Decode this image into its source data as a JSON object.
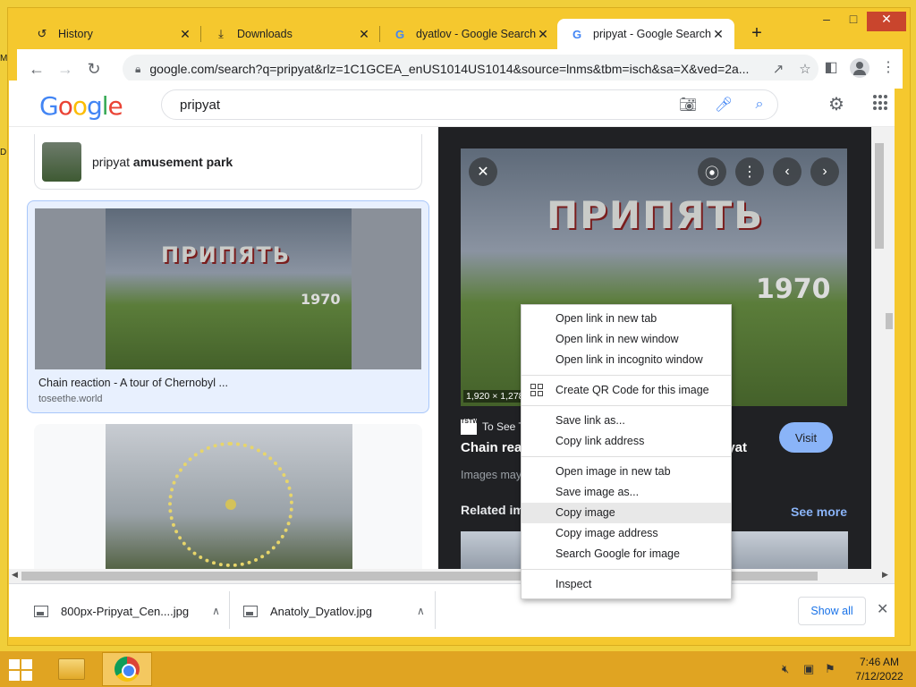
{
  "tabs": [
    {
      "label": "History",
      "icon": "history-icon"
    },
    {
      "label": "Downloads",
      "icon": "download-icon"
    },
    {
      "label": "dyatlov - Google Search",
      "icon": "google-icon"
    },
    {
      "label": "pripyat - Google Search",
      "icon": "google-icon",
      "active": true
    }
  ],
  "toolbar": {
    "url": "google.com/search?q=pripyat&rlz=1C1GCEA_enUS1014US1014&source=lnms&tbm=isch&sa=X&ved=2a..."
  },
  "google": {
    "logo": [
      "G",
      "o",
      "o",
      "g",
      "l",
      "e"
    ],
    "query": "pripyat"
  },
  "results": {
    "suggestion_prefix": "pripyat",
    "suggestion_bold": "amusement park",
    "card1": {
      "title": "Chain reaction - A tour of Chernobyl ...",
      "source": "toseethe.world",
      "sign_text": "ПРИПЯТЬ",
      "year": "1970"
    }
  },
  "preview": {
    "dimensions": "1,920 × 1,278",
    "source_name": "To See T",
    "favicon_text": "TSTW",
    "title_left": "Chain reac",
    "title_right": "ipyat",
    "visit_label": "Visit",
    "note": "Images may",
    "related_label": "Related im",
    "see_more": "See more",
    "sign_text": "ПРИПЯТЬ",
    "year": "1970"
  },
  "context_menu": [
    {
      "label": "Open link in new tab"
    },
    {
      "label": "Open link in new window"
    },
    {
      "label": "Open link in incognito window"
    },
    {
      "separator": true
    },
    {
      "label": "Create QR Code for this image",
      "icon": "qr-code-icon"
    },
    {
      "separator": true
    },
    {
      "label": "Save link as..."
    },
    {
      "label": "Copy link address"
    },
    {
      "separator": true
    },
    {
      "label": "Open image in new tab"
    },
    {
      "label": "Save image as..."
    },
    {
      "label": "Copy image",
      "highlighted": true
    },
    {
      "label": "Copy image address"
    },
    {
      "label": "Search Google for image"
    },
    {
      "separator": true
    },
    {
      "label": "Inspect"
    }
  ],
  "downloads": [
    {
      "name": "800px-Pripyat_Cen....jpg"
    },
    {
      "name": "Anatoly_Dyatlov.jpg"
    }
  ],
  "shelf": {
    "show_all": "Show all"
  },
  "taskbar": {
    "time": "7:46 AM",
    "date": "7/12/2022"
  }
}
